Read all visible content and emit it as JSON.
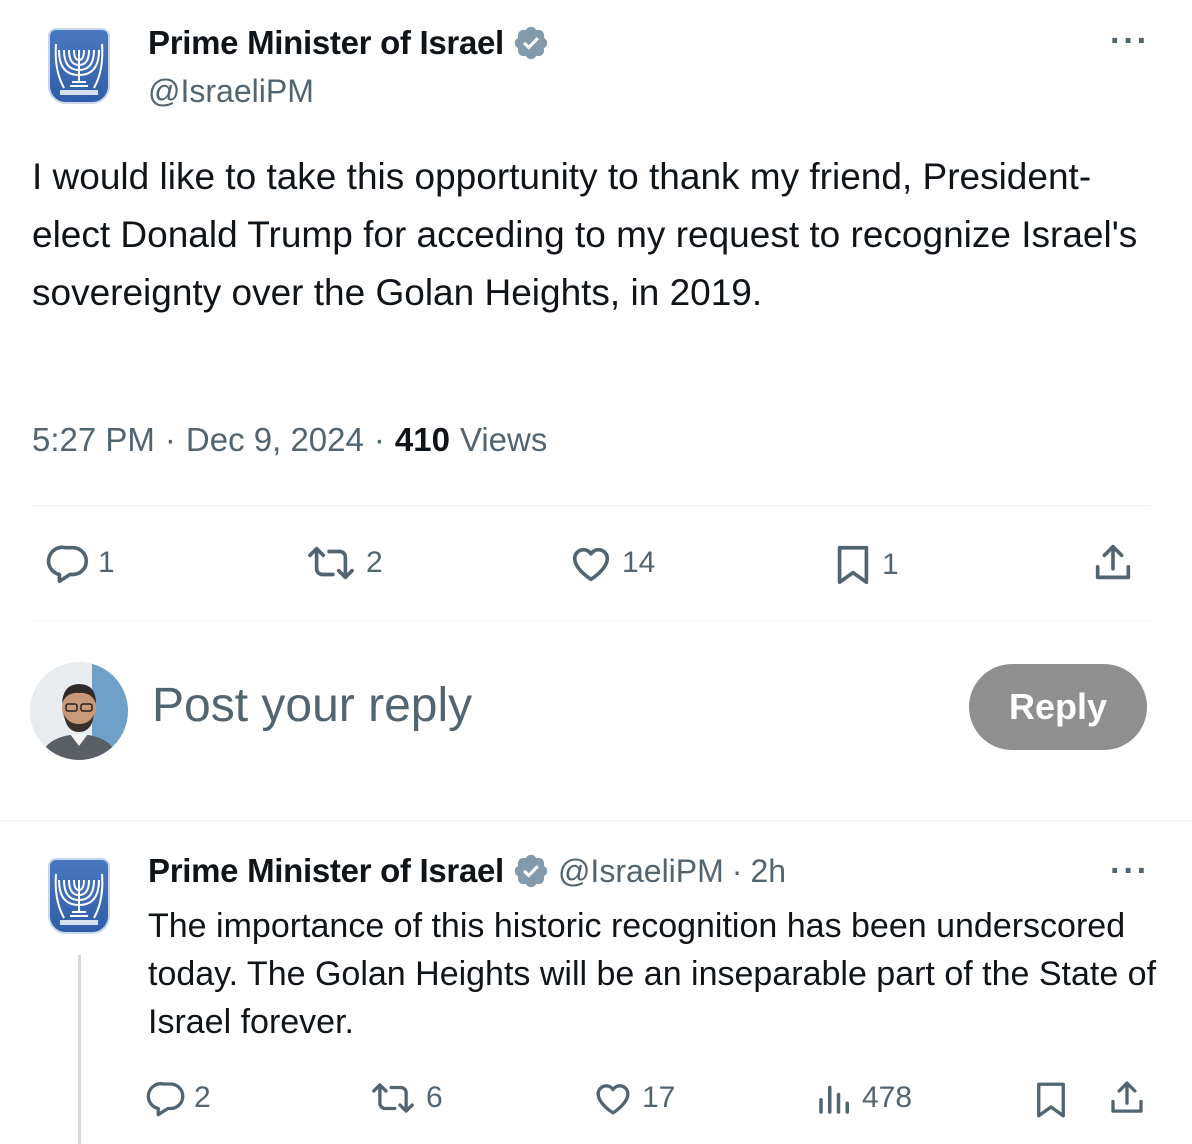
{
  "main_post": {
    "author_name": "Prime Minister of Israel",
    "handle": "@IsraeliPM",
    "text": "I would like to take this opportunity to thank my friend, President-elect Donald Trump for acceding to my request to recognize Israel's sovereignty over the Golan Heights, in 2019.",
    "time": "5:27 PM",
    "date": "Dec 9, 2024",
    "views_count": "410",
    "views_label": "Views",
    "replies": "1",
    "reposts": "2",
    "likes": "14",
    "bookmarks": "1"
  },
  "composer": {
    "placeholder": "Post your reply",
    "reply_button": "Reply"
  },
  "reply_post": {
    "author_name": "Prime Minister of Israel",
    "handle": "@IsraeliPM",
    "time_ago": "2h",
    "text": "The importance of this historic recognition has been underscored today. The Golan Heights will be an inseparable part of the State of Israel forever.",
    "replies": "2",
    "reposts": "6",
    "likes": "17",
    "views": "478"
  },
  "colors": {
    "verified_badge": "#829aab",
    "muted_text": "#536471",
    "reply_button_bg": "#8f8f8f",
    "emblem_blue": "#2f5ea8"
  },
  "icons": [
    "verified-badge-icon",
    "more-icon",
    "reply-icon",
    "repost-icon",
    "like-icon",
    "bookmark-icon",
    "share-icon",
    "views-icon"
  ]
}
